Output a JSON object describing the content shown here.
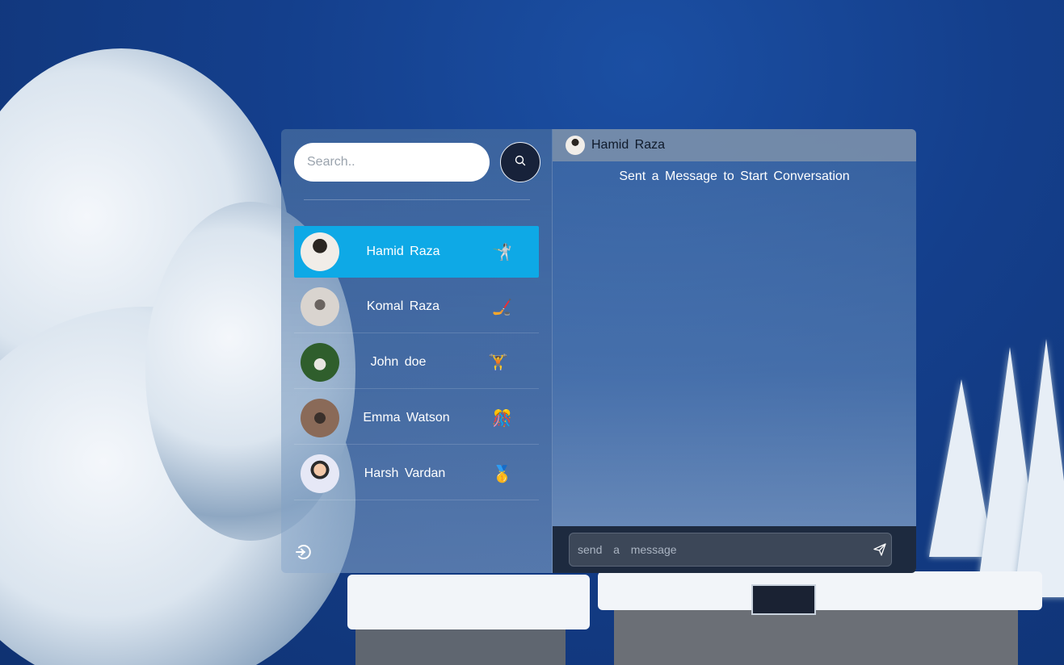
{
  "search": {
    "placeholder": "Search.."
  },
  "contacts": [
    {
      "name": "Hamid  Raza",
      "emoji": "🤺",
      "active": true
    },
    {
      "name": "Komal  Raza",
      "emoji": "🏒",
      "active": false
    },
    {
      "name": "John  doe",
      "emoji": "🏋️",
      "active": false
    },
    {
      "name": "Emma  Watson",
      "emoji": "🎊",
      "active": false
    },
    {
      "name": "Harsh  Vardan",
      "emoji": "🥇",
      "active": false
    }
  ],
  "chat": {
    "header_name": "Hamid  Raza",
    "empty_text": "Sent  a  Message  to  Start  Conversation",
    "message_placeholder": "send  a  message"
  },
  "icons": {
    "search": "search-icon",
    "logout": "logout-icon",
    "send": "send-icon"
  },
  "colors": {
    "active_contact": "#0ea9e6",
    "search_button": "#17223a",
    "composer_bg": "#1d2a3f"
  }
}
